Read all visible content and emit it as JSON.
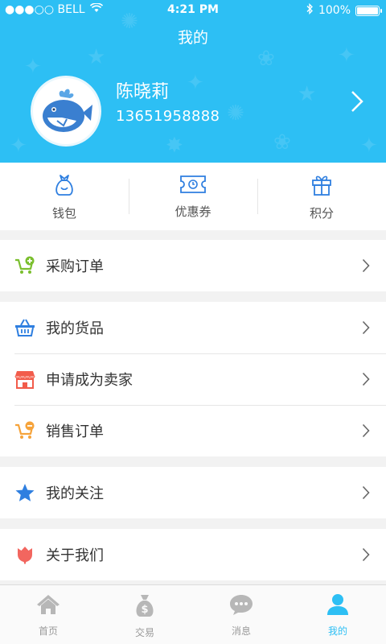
{
  "status_bar": {
    "carrier": "●●●○○ BELL",
    "time": "4:21 PM",
    "battery": "100%"
  },
  "header": {
    "title": "我的"
  },
  "profile": {
    "name": "陈晓莉",
    "phone": "13651958888"
  },
  "quick_actions": [
    {
      "label": "钱包",
      "icon": "wallet-icon"
    },
    {
      "label": "优惠券",
      "icon": "coupon-icon"
    },
    {
      "label": "积分",
      "icon": "gift-icon"
    }
  ],
  "menu": {
    "purchase_orders": {
      "label": "采购订单",
      "icon": "cart-plus-icon"
    },
    "my_goods": {
      "label": "我的货品",
      "icon": "basket-icon"
    },
    "become_seller": {
      "label": "申请成为卖家",
      "icon": "store-icon"
    },
    "sales_orders": {
      "label": "销售订单",
      "icon": "cart-minus-icon"
    },
    "my_follows": {
      "label": "我的关注",
      "icon": "star-icon"
    },
    "about_us": {
      "label": "关于我们",
      "icon": "tulip-icon"
    }
  },
  "colors": {
    "brand_blue": "#2dbff4",
    "green": "#7bbf2f",
    "blue": "#2f7fe0",
    "red": "#f25c4b",
    "orange": "#f6a33a",
    "pink": "#f2665f"
  },
  "tabs": [
    {
      "label": "首页",
      "icon": "home-icon",
      "active": false
    },
    {
      "label": "交易",
      "icon": "money-bag-icon",
      "active": false
    },
    {
      "label": "消息",
      "icon": "chat-icon",
      "active": false
    },
    {
      "label": "我的",
      "icon": "person-icon",
      "active": true
    }
  ]
}
